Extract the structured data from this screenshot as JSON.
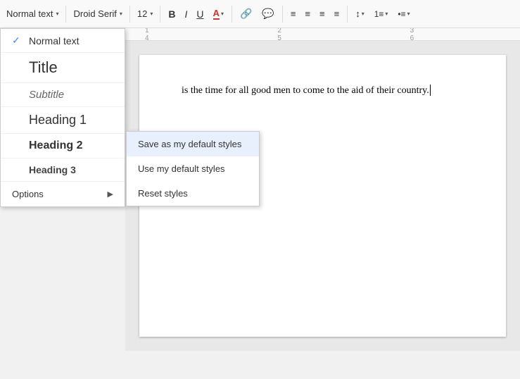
{
  "toolbar": {
    "style_label": "Normal text",
    "font_label": "Droid Serif",
    "size_label": "12",
    "bold_label": "B",
    "italic_label": "I",
    "underline_label": "U",
    "color_label": "A",
    "caret": "▾"
  },
  "style_menu": {
    "items": [
      {
        "id": "normal-text",
        "label": "Normal text",
        "selected": true
      },
      {
        "id": "title",
        "label": "Title",
        "selected": false
      },
      {
        "id": "subtitle",
        "label": "Subtitle",
        "selected": false
      },
      {
        "id": "heading1",
        "label": "Heading 1",
        "selected": false
      },
      {
        "id": "heading2",
        "label": "Heading 2",
        "selected": false
      },
      {
        "id": "heading3",
        "label": "Heading 3",
        "selected": false
      }
    ],
    "options_label": "Options",
    "options_arrow": "▶",
    "submenu": [
      {
        "id": "save-default",
        "label": "Save as my default styles",
        "highlighted": true
      },
      {
        "id": "use-default",
        "label": "Use my default styles",
        "highlighted": false
      },
      {
        "id": "reset-styles",
        "label": "Reset styles",
        "highlighted": false
      }
    ]
  },
  "document": {
    "text": "is the time for all good men to come to the aid of their country."
  },
  "ruler": {
    "marks": [
      "1",
      "2",
      "3",
      "4",
      "5",
      "6"
    ]
  }
}
